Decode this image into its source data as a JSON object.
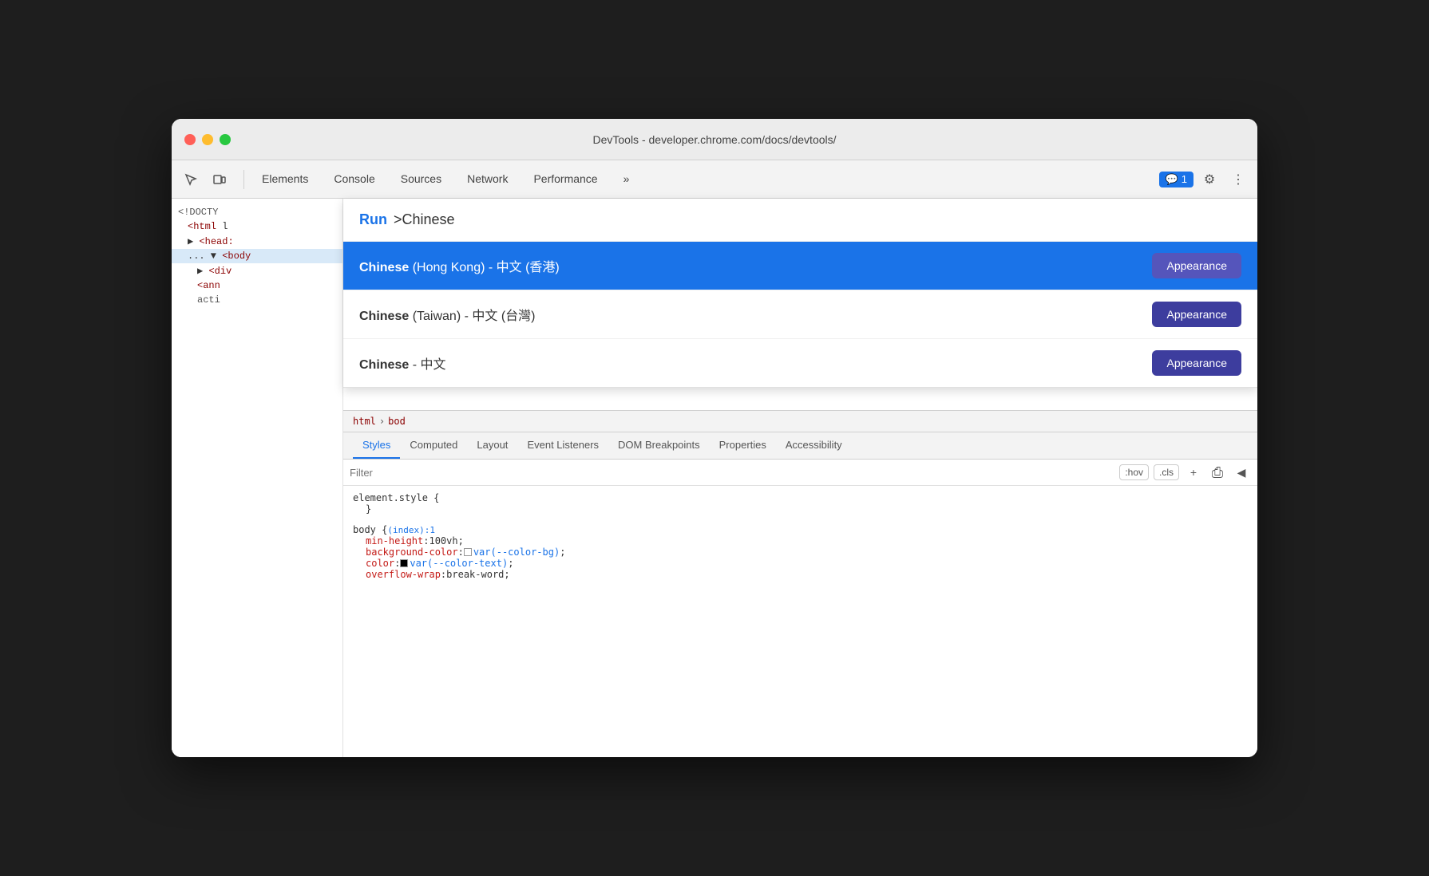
{
  "window": {
    "title": "DevTools - developer.chrome.com/docs/devtools/"
  },
  "traffic_lights": {
    "red": "close",
    "yellow": "minimize",
    "green": "maximize"
  },
  "toolbar": {
    "tabs": [
      "Elements",
      "Console",
      "Sources",
      "Network",
      "Performance"
    ],
    "more_label": "»",
    "chat_count": "1",
    "settings_label": "⚙",
    "more_options_label": "⋮"
  },
  "elements_panel": {
    "lines": [
      {
        "text": "<!DOCTY",
        "type": "text"
      },
      {
        "text": "<html l",
        "tag": true
      },
      {
        "text": "▶ <head:",
        "tag": true
      },
      {
        "text": "... ▼ <body:",
        "tag": true
      },
      {
        "text": "▶ <div",
        "tag": true
      },
      {
        "text": "<ann",
        "tag": true
      },
      {
        "text": "acti",
        "type": "text"
      }
    ]
  },
  "breadcrumb": {
    "items": [
      "html",
      "bod"
    ]
  },
  "command_dropdown": {
    "run_label": "Run",
    "query": ">Chinese",
    "items": [
      {
        "bold": "Chinese",
        "rest": " (Hong Kong) - 中文 (香港)",
        "button": "Appearance",
        "selected": true
      },
      {
        "bold": "Chinese",
        "rest": " (Taiwan) - 中文 (台灣)",
        "button": "Appearance",
        "selected": false
      },
      {
        "bold": "Chinese",
        "rest": " - 中文",
        "button": "Appearance",
        "selected": false
      }
    ]
  },
  "styles_tabs": {
    "tabs": [
      "Styles",
      "Computed",
      "Layout",
      "Event Listeners",
      "DOM Breakpoints",
      "Properties",
      "Accessibility"
    ],
    "active": "Styles"
  },
  "filter": {
    "placeholder": "Filter",
    "hov_label": ":hov",
    "cls_label": ".cls"
  },
  "css_rules": {
    "rule1": {
      "selector": "element.style {",
      "close": "}"
    },
    "rule2": {
      "selector": "body {",
      "link": "(index):1",
      "close": "}",
      "props": [
        {
          "prop": "min-height",
          "colon": ":",
          "value": " 100vh;"
        },
        {
          "prop": "background-color",
          "colon": ":",
          "swatch": "white",
          "value": " var(--color-bg);"
        },
        {
          "prop": "color",
          "colon": ":",
          "swatch": "black",
          "value": " var(--color-text);"
        },
        {
          "prop": "overflow-wrap",
          "colon": ":",
          "value": " break-word;"
        }
      ]
    }
  }
}
